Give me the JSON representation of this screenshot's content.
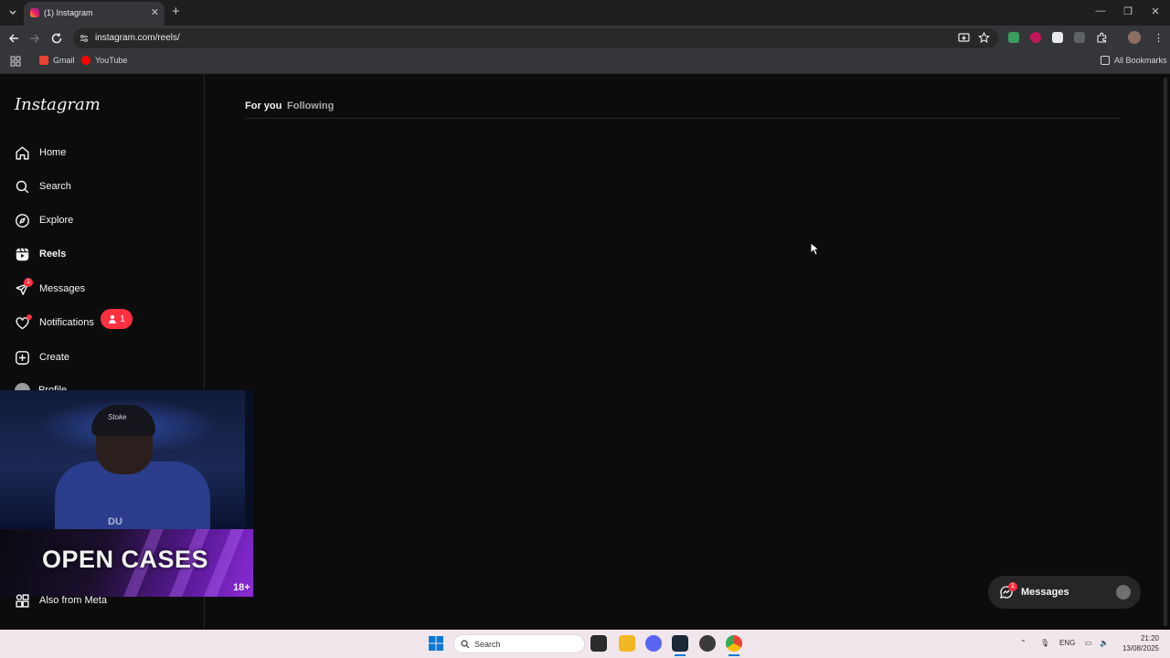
{
  "browser": {
    "tab_title": "(1) Instagram",
    "url": "instagram.com/reels/",
    "bookmarks": [
      "Gmail",
      "YouTube"
    ],
    "all_bookmarks": "All Bookmarks"
  },
  "instagram": {
    "logo": "Instagram",
    "nav": [
      {
        "label": "Home",
        "icon": "home-icon"
      },
      {
        "label": "Search",
        "icon": "search-icon"
      },
      {
        "label": "Explore",
        "icon": "compass-icon"
      },
      {
        "label": "Reels",
        "icon": "reels-icon",
        "active": true
      },
      {
        "label": "Messages",
        "icon": "messenger-icon",
        "badge": "1"
      },
      {
        "label": "Notifications",
        "icon": "heart-icon"
      },
      {
        "label": "Create",
        "icon": "plus-square-icon"
      },
      {
        "label": "Profile",
        "icon": "avatar"
      },
      {
        "label": "Also from Meta",
        "icon": "meta-apps-icon"
      }
    ],
    "notification_pill_count": "1",
    "feed_tabs": [
      "For you",
      "Following"
    ],
    "messages_pill": {
      "label": "Messages",
      "badge": "1"
    }
  },
  "overlay": {
    "jersey_text": "Stoke",
    "jersey_number": "DU",
    "promo_title": "OPEN CASES",
    "age_rating": "18+"
  },
  "taskbar": {
    "search_placeholder": "Search",
    "language": "ENG",
    "time": "21:20",
    "date": "13/08/2025"
  },
  "colors": {
    "accent_red": "#ff3040",
    "background": "#0c0c0d",
    "chrome_dark": "#35363a"
  }
}
